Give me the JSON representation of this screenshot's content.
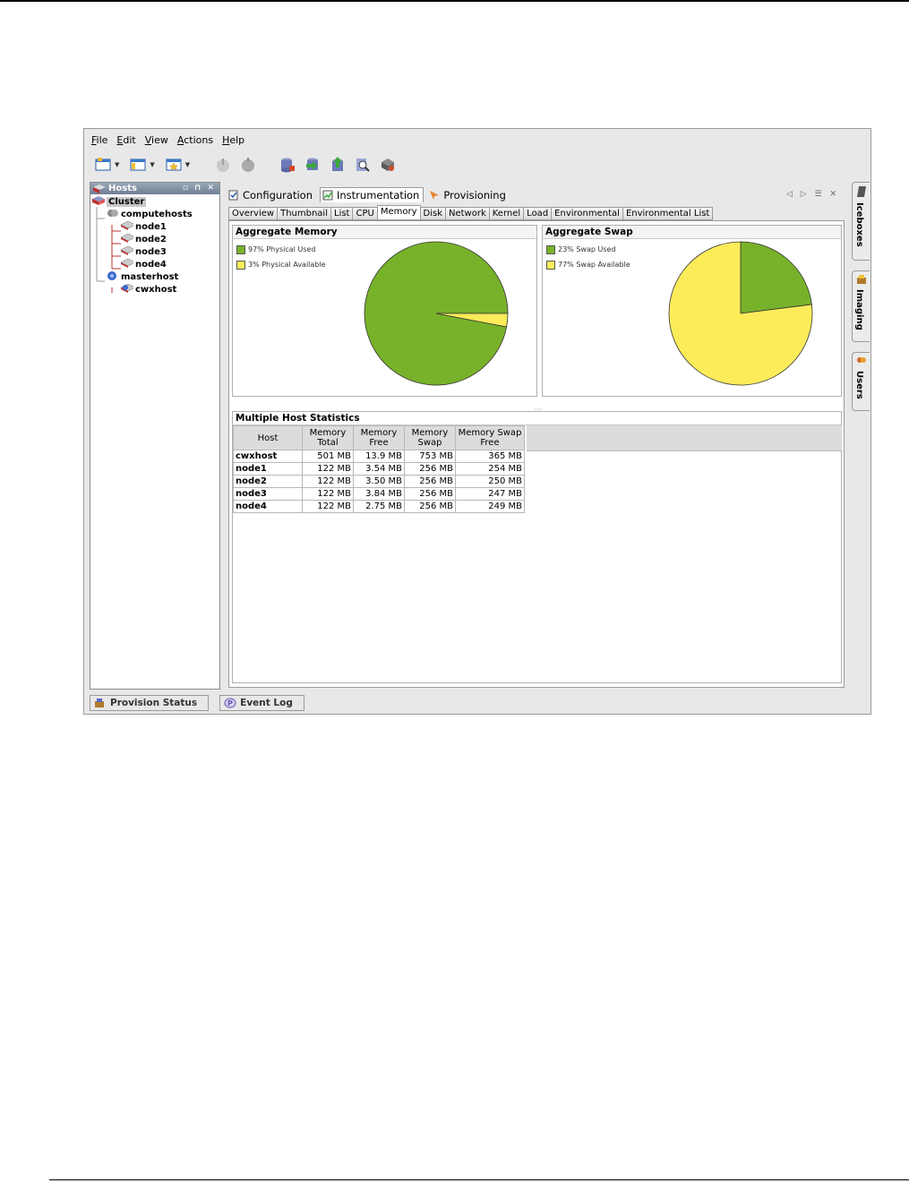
{
  "menu": [
    {
      "label": "File",
      "underline": "F",
      "rest": "ile"
    },
    {
      "label": "Edit",
      "underline": "E",
      "rest": "dit"
    },
    {
      "label": "View",
      "underline": "V",
      "rest": "iew"
    },
    {
      "label": "Actions",
      "underline": "A",
      "rest": "ctions"
    },
    {
      "label": "Help",
      "underline": "H",
      "rest": "elp"
    }
  ],
  "hosts": {
    "title": "Hosts",
    "tree": {
      "cluster": "Cluster",
      "computehosts": "computehosts",
      "nodes": [
        "node1",
        "node2",
        "node3",
        "node4"
      ],
      "masterhost": "masterhost",
      "cwxhost": "cwxhost"
    }
  },
  "main_tabs": [
    "Configuration",
    "Instrumentation",
    "Provisioning"
  ],
  "sub_tabs": [
    "Overview",
    "Thumbnail",
    "List",
    "CPU",
    "Memory",
    "Disk",
    "Network",
    "Kernel",
    "Load",
    "Environmental",
    "Environmental List"
  ],
  "side_tabs": [
    "Iceboxes",
    "Imaging",
    "Users"
  ],
  "aggregate_memory": {
    "title": "Aggregate Memory",
    "legend": [
      "97% Physical Used",
      "3% Physical Available"
    ]
  },
  "aggregate_swap": {
    "title": "Aggregate Swap",
    "legend": [
      "23% Swap Used",
      "77% Swap Available"
    ]
  },
  "colors": {
    "used": "#78b22a",
    "available": "#fdec5a"
  },
  "chart_data": [
    {
      "type": "pie",
      "title": "Aggregate Memory",
      "labels": [
        "97% Physical Used",
        "3% Physical Available"
      ],
      "values": [
        97,
        3
      ]
    },
    {
      "type": "pie",
      "title": "Aggregate Swap",
      "labels": [
        "23% Swap Used",
        "77% Swap Available"
      ],
      "values": [
        23,
        77
      ]
    }
  ],
  "stats": {
    "title": "Multiple Host Statistics",
    "columns": [
      {
        "l1": "",
        "l2": "Host"
      },
      {
        "l1": "Memory",
        "l2": "Total"
      },
      {
        "l1": "Memory",
        "l2": "Free"
      },
      {
        "l1": "Memory",
        "l2": "Swap"
      },
      {
        "l1": "Memory Swap",
        "l2": "Free"
      }
    ],
    "rows": [
      [
        "cwxhost",
        "501 MB",
        "13.9 MB",
        "753 MB",
        "365 MB"
      ],
      [
        "node1",
        "122 MB",
        "3.54 MB",
        "256 MB",
        "254 MB"
      ],
      [
        "node2",
        "122 MB",
        "3.50 MB",
        "256 MB",
        "250 MB"
      ],
      [
        "node3",
        "122 MB",
        "3.84 MB",
        "256 MB",
        "247 MB"
      ],
      [
        "node4",
        "122 MB",
        "2.75 MB",
        "256 MB",
        "249 MB"
      ]
    ]
  },
  "status_tabs": [
    "Provision Status",
    "Event Log"
  ]
}
